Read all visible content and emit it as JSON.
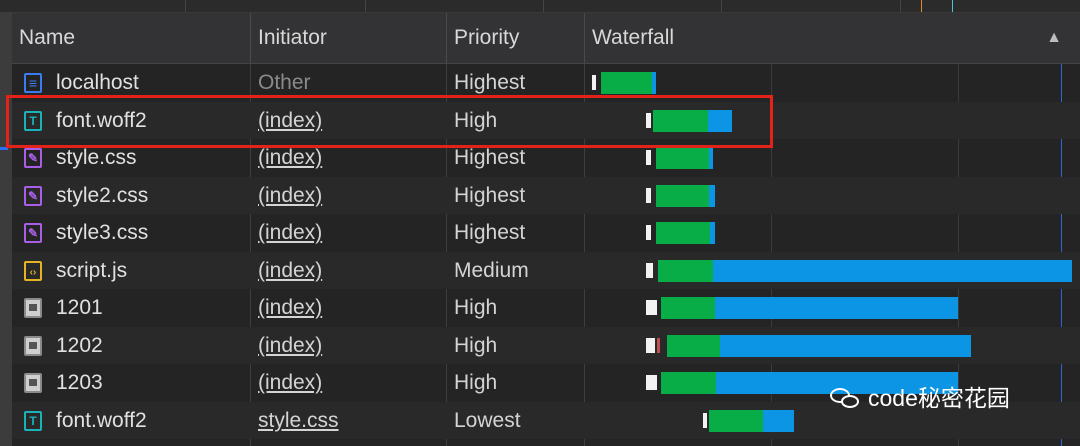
{
  "columns": {
    "name": "Name",
    "initiator": "Initiator",
    "priority": "Priority",
    "waterfall": "Waterfall"
  },
  "sort_indicator": "▲",
  "rows": [
    {
      "name": "localhost",
      "initiator": "Other",
      "priority": "Highest",
      "type": "document"
    },
    {
      "name": "font.woff2",
      "initiator": "(index)",
      "priority": "High",
      "type": "font"
    },
    {
      "name": "style.css",
      "initiator": "(index)",
      "priority": "Highest",
      "type": "stylesheet"
    },
    {
      "name": "style2.css",
      "initiator": "(index)",
      "priority": "Highest",
      "type": "stylesheet"
    },
    {
      "name": "style3.css",
      "initiator": "(index)",
      "priority": "Highest",
      "type": "stylesheet"
    },
    {
      "name": "script.js",
      "initiator": "(index)",
      "priority": "Medium",
      "type": "script"
    },
    {
      "name": "1201",
      "initiator": "(index)",
      "priority": "High",
      "type": "image"
    },
    {
      "name": "1202",
      "initiator": "(index)",
      "priority": "High",
      "type": "image"
    },
    {
      "name": "1203",
      "initiator": "(index)",
      "priority": "High",
      "type": "image"
    },
    {
      "name": "font.woff2",
      "initiator": "style.css",
      "priority": "Lowest",
      "type": "font"
    }
  ],
  "watermark": {
    "text": "code秘密花园",
    "icon": "wechat-icon"
  },
  "colors": {
    "waiting": "#08ad48",
    "download": "#0d95e5",
    "highlight": "#e3231a",
    "dom_line": "#2f63d8"
  },
  "icons": {
    "document": "document-icon",
    "font": "font-icon",
    "stylesheet": "stylesheet-icon",
    "script": "script-icon",
    "image": "image-icon"
  }
}
